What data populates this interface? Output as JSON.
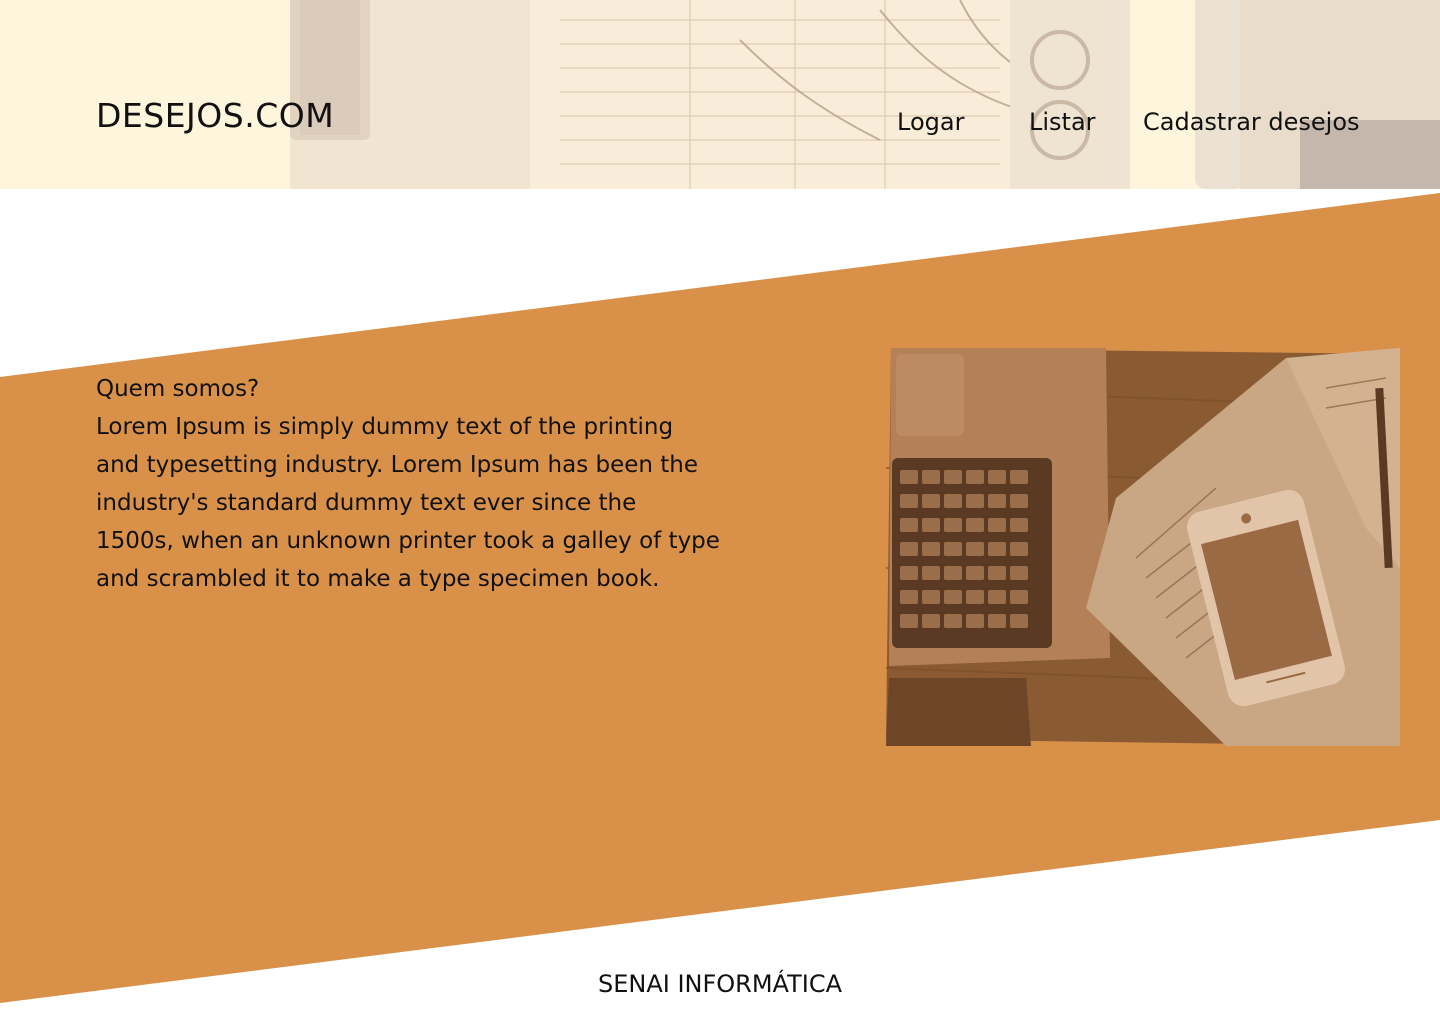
{
  "header": {
    "logo": "DESEJOS.COM",
    "nav": [
      {
        "label": "Logar"
      },
      {
        "label": "Listar"
      },
      {
        "label": "Cadastrar desejos"
      }
    ]
  },
  "about": {
    "title": "Quem somos?",
    "body": "Lorem Ipsum is simply dummy text of the printing\nand typesetting industry. Lorem Ipsum has been the\nindustry's standard dummy text ever since the\n1500s, when an unknown printer took a galley of type\nand scrambled it to make a type specimen book."
  },
  "footer": {
    "text": "SENAI INFORMÁTICA"
  },
  "colors": {
    "accent": "#d9914a",
    "header_bg": "#fdf6dc"
  }
}
